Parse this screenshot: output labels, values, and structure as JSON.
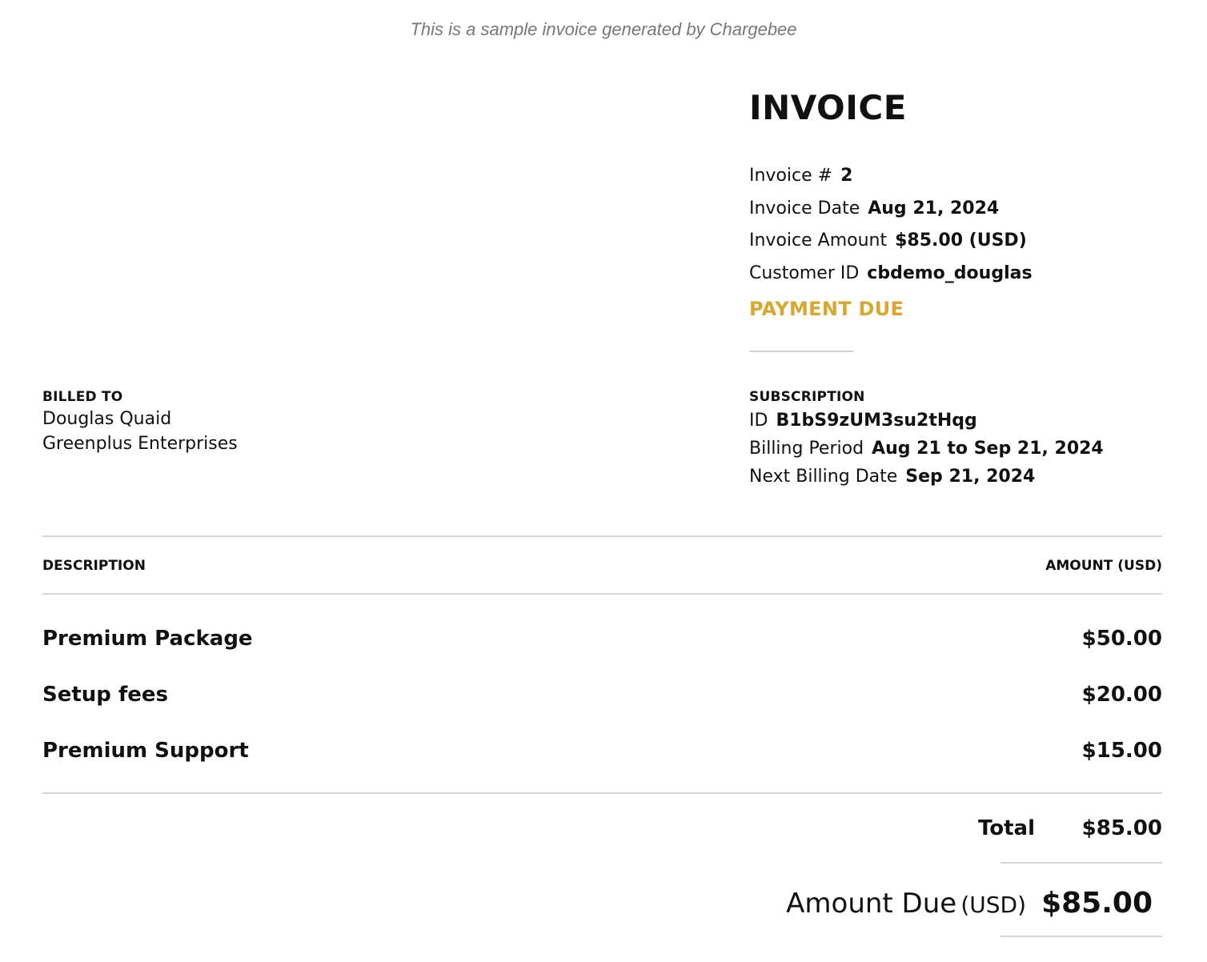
{
  "header_note": "This is a sample invoice generated by Chargebee",
  "invoice": {
    "title": "INVOICE",
    "number_label": "Invoice #",
    "number": "2",
    "date_label": "Invoice Date",
    "date": "Aug 21, 2024",
    "amount_label": "Invoice Amount",
    "amount": "$85.00 (USD)",
    "customer_id_label": "Customer ID",
    "customer_id": "cbdemo_douglas",
    "status": "PAYMENT DUE"
  },
  "billed_to": {
    "heading": "BILLED TO",
    "name": "Douglas Quaid",
    "company": "Greenplus Enterprises"
  },
  "subscription": {
    "heading": "SUBSCRIPTION",
    "id_label": "ID",
    "id": "B1bS9zUM3su2tHqg",
    "billing_period_label": "Billing Period",
    "billing_period": "Aug 21 to Sep 21, 2024",
    "next_billing_label": "Next Billing Date",
    "next_billing": "Sep 21, 2024"
  },
  "table": {
    "col_description": "DESCRIPTION",
    "col_amount": "AMOUNT (USD)",
    "items": [
      {
        "description": "Premium Package",
        "amount": "$50.00"
      },
      {
        "description": "Setup fees",
        "amount": "$20.00"
      },
      {
        "description": "Premium Support",
        "amount": "$15.00"
      }
    ]
  },
  "totals": {
    "total_label": "Total",
    "total": "$85.00",
    "amount_due_label": "Amount Due",
    "amount_due_unit": "(USD)",
    "amount_due": "$85.00"
  },
  "colors": {
    "status": "#d9a62e",
    "rule": "#d6d6d6",
    "note": "#777777"
  }
}
